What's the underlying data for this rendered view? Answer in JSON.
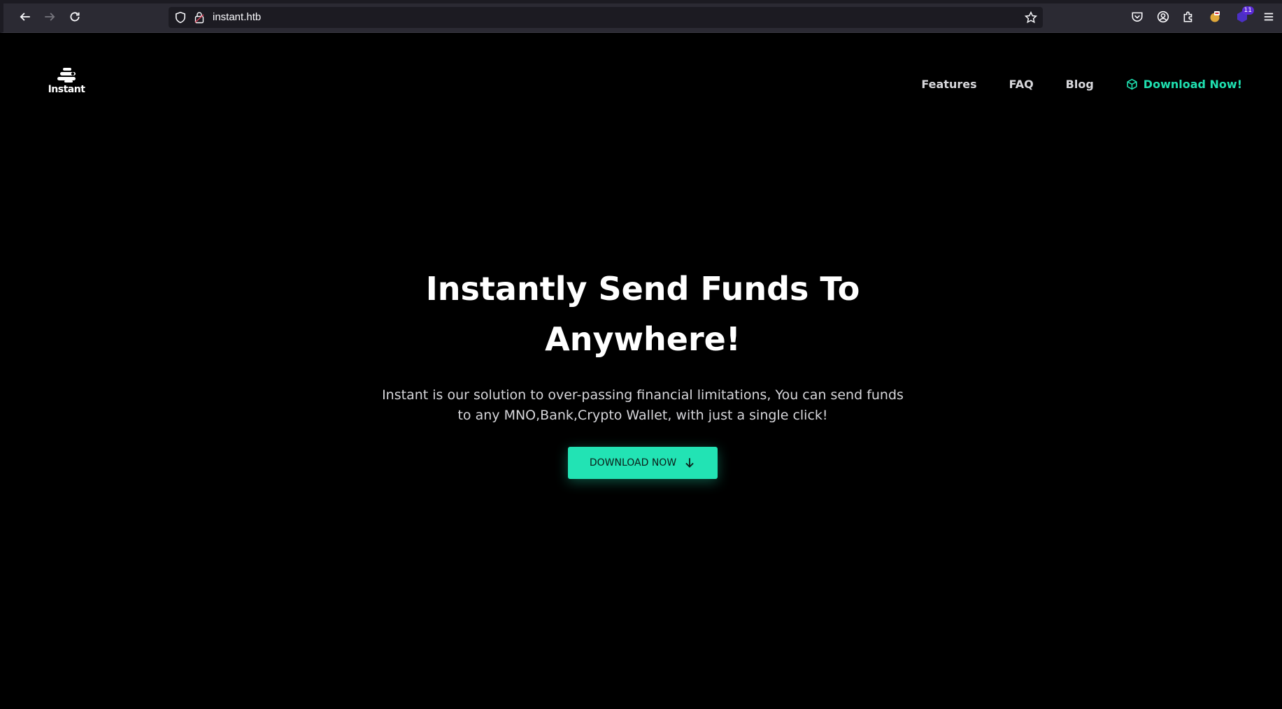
{
  "browser": {
    "url": "instant.htb",
    "extension_badge": "11",
    "icons": [
      "back-icon",
      "forward-icon",
      "reload-icon",
      "shield-icon",
      "lock-icon",
      "star-icon",
      "pocket-icon",
      "account-icon",
      "extensions-icon",
      "extension-icon",
      "extension-icon",
      "menu-icon"
    ]
  },
  "site": {
    "logo_text": "Instant",
    "nav": {
      "features": "Features",
      "faq": "FAQ",
      "blog": "Blog",
      "download": "Download Now!"
    },
    "hero": {
      "title": "Instantly Send Funds To Anywhere!",
      "description": "Instant is our solution to over-passing financial limitations, You can send funds to any MNO,Bank,Crypto Wallet, with just a single click!",
      "button_label": "DOWNLOAD NOW"
    },
    "colors": {
      "accent": "#22e3b4",
      "background": "#000000"
    }
  }
}
